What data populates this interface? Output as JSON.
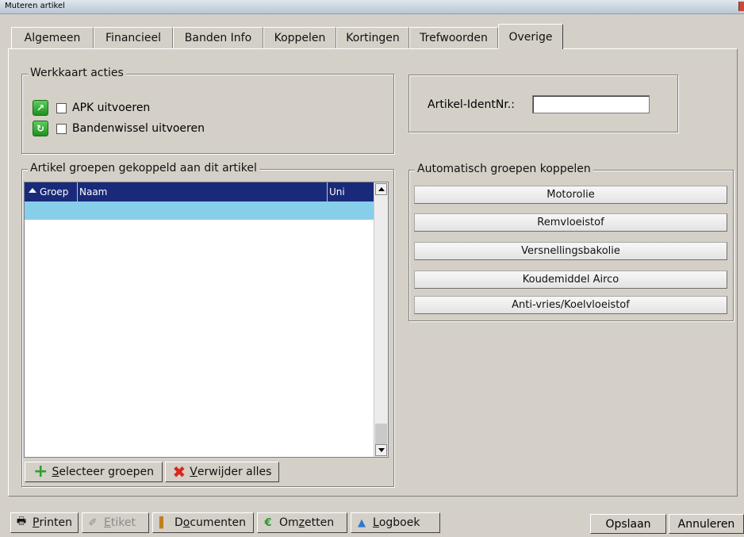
{
  "window": {
    "title": "Muteren artikel"
  },
  "tabs": [
    {
      "label": "Algemeen"
    },
    {
      "label": "Financieel"
    },
    {
      "label": "Banden Info"
    },
    {
      "label": "Koppelen"
    },
    {
      "label": "Kortingen"
    },
    {
      "label": "Trefwoorden"
    },
    {
      "label": "Overige",
      "active": true
    }
  ],
  "werkkaart": {
    "legend": "Werkkaart acties",
    "apk_label": "APK uitvoeren",
    "apk_checked": false,
    "banden_label": "Bandenwissel uitvoeren",
    "banden_checked": false
  },
  "ident": {
    "label": "Artikel-IdentNr.:",
    "value": ""
  },
  "groepen": {
    "legend": "Artikel groepen gekoppeld aan dit artikel",
    "columns": [
      "Groep",
      "Naam",
      "Uni"
    ],
    "rows": [],
    "select_prefix": "",
    "select_hot": "S",
    "select_rest": "electeer groepen",
    "remove_hot": "V",
    "remove_rest": "erwijder alles"
  },
  "automatisch": {
    "legend": "Automatisch groepen koppelen",
    "buttons": [
      "Motorolie",
      "Remvloeistof",
      "Versnellingsbakolie",
      "Koudemiddel Airco",
      "Anti-vries/Koelvloeistof"
    ]
  },
  "bottom": {
    "printen": {
      "hot": "P",
      "rest": "rinten"
    },
    "etiket": {
      "hot": "E",
      "rest": "tiket"
    },
    "documenten": {
      "pre": "D",
      "hot": "o",
      "rest": "cumenten"
    },
    "omzetten": {
      "pre": "Om",
      "hot": "z",
      "rest": "etten"
    },
    "logboek": {
      "hot": "L",
      "rest": "ogboek"
    },
    "save": "Opslaan",
    "cancel": "Annuleren"
  }
}
